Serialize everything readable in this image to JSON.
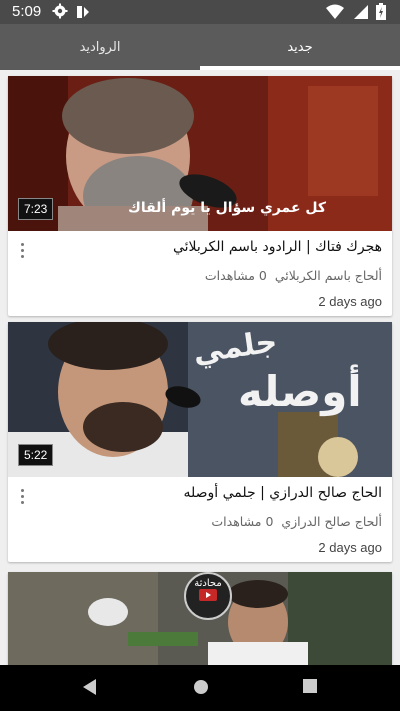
{
  "status_bar": {
    "time": "5:09"
  },
  "tabs": {
    "left_label": "الروادید",
    "right_label": "جديد",
    "selected": "جديد"
  },
  "videos": [
    {
      "title": "هجرك فتاك | الرادود باسم الكربلائي",
      "channel": "ألحاج باسم الكربلائي",
      "views": "0 مشاهدات",
      "date": "2 days ago",
      "duration": "7:23",
      "thumb_caption": "كل عمري سؤال  يا يوم ألقاك"
    },
    {
      "title": "الحاج صالح الدرازي | جلمي أوصله",
      "channel": "ألحاج صالح الدرازي",
      "views": "0 مشاهدات",
      "date": "2 days ago",
      "duration": "5:22",
      "thumb_caption": "أوصله",
      "thumb_caption_top": "جلمي"
    },
    {
      "badge": "محادثة"
    }
  ],
  "colors": {
    "status_bar": "#4a4a4a",
    "tab_bar": "#5b5b5b",
    "indicator": "#ffffff",
    "background": "#efefef"
  },
  "icons": [
    "gear-icon",
    "notification-icon",
    "wifi-icon",
    "signal-icon",
    "battery-icon",
    "back-icon",
    "home-icon",
    "recents-icon",
    "more-vert-icon"
  ]
}
